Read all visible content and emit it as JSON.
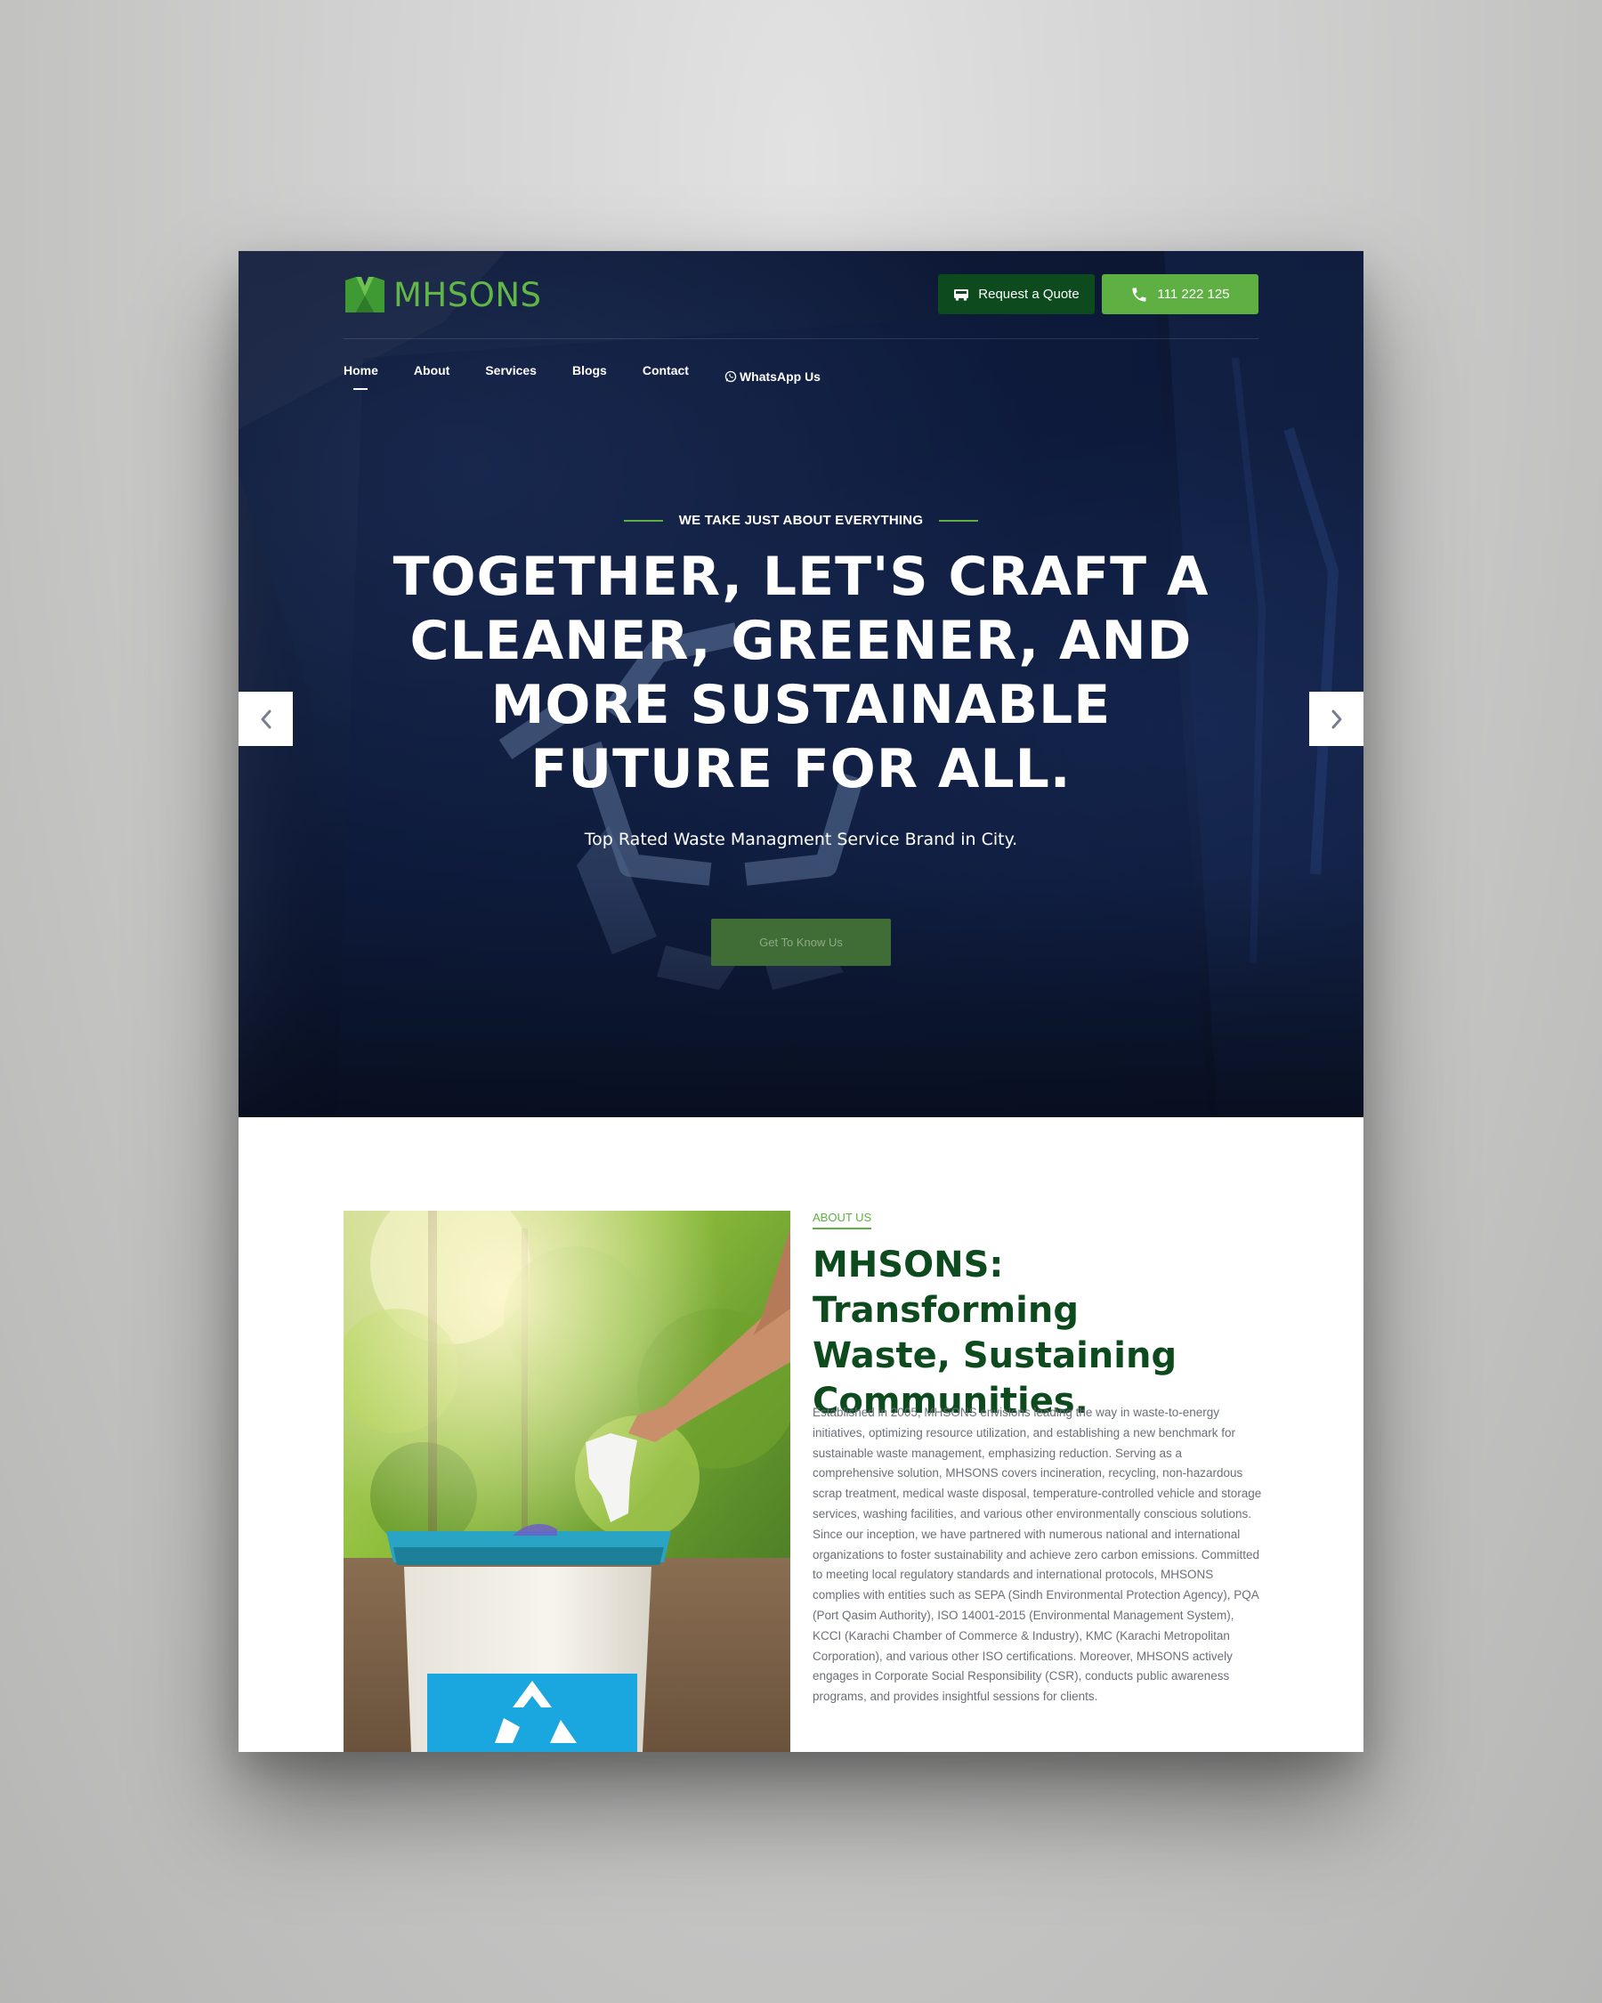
{
  "brand": {
    "name": "MHSONS",
    "accent": "#5fb043",
    "dark_green": "#0d4a1e"
  },
  "header": {
    "quote_label": "Request a Quote",
    "quote_icon": "truck-icon",
    "phone_label": "111 222 125",
    "phone_icon": "phone-icon"
  },
  "nav": {
    "items": [
      {
        "label": "Home",
        "active": true
      },
      {
        "label": "About"
      },
      {
        "label": "Services"
      },
      {
        "label": "Blogs"
      },
      {
        "label": "Contact"
      },
      {
        "label": "WhatsApp Us",
        "icon": "whatsapp-icon"
      }
    ]
  },
  "hero": {
    "eyebrow": "WE TAKE JUST ABOUT EVERYTHING",
    "headline_lines": [
      "TOGETHER, LET'S CRAFT A",
      "CLEANER, GREENER, AND",
      "MORE SUSTAINABLE",
      "FUTURE FOR ALL."
    ],
    "subline": "Top Rated Waste Managment Service Brand in City.",
    "cta_label": "Get To Know Us",
    "prev_icon": "chevron-left-icon",
    "next_icon": "chevron-right-icon"
  },
  "about": {
    "label": "ABOUT US",
    "title_lines": [
      "MHSONS: Transforming",
      "Waste, Sustaining",
      "Communities."
    ],
    "body": "Established in 2005, MHSONS envisions leading the way in waste-to-energy initiatives, optimizing resource utilization, and establishing a new benchmark for sustainable waste management, emphasizing reduction. Serving as a comprehensive solution, MHSONS covers incineration, recycling, non-hazardous scrap treatment, medical waste disposal, temperature-controlled vehicle and storage services, washing facilities, and various other environmentally conscious solutions. Since our inception, we have partnered with numerous national and international organizations to foster sustainability and achieve zero carbon emissions. Committed to meeting local regulatory standards and international protocols, MHSONS complies with entities such as SEPA (Sindh Environmental Protection Agency), PQA (Port Qasim Authority), ISO 14001-2015 (Environmental Management System), KCCI (Karachi Chamber of Commerce & Industry), KMC (Karachi Metropolitan Corporation), and various other ISO certifications. Moreover, MHSONS actively engages in Corporate Social Responsibility (CSR), conducts public awareness programs, and provides insightful sessions for clients.",
    "image_icon": "recycle-icon"
  }
}
